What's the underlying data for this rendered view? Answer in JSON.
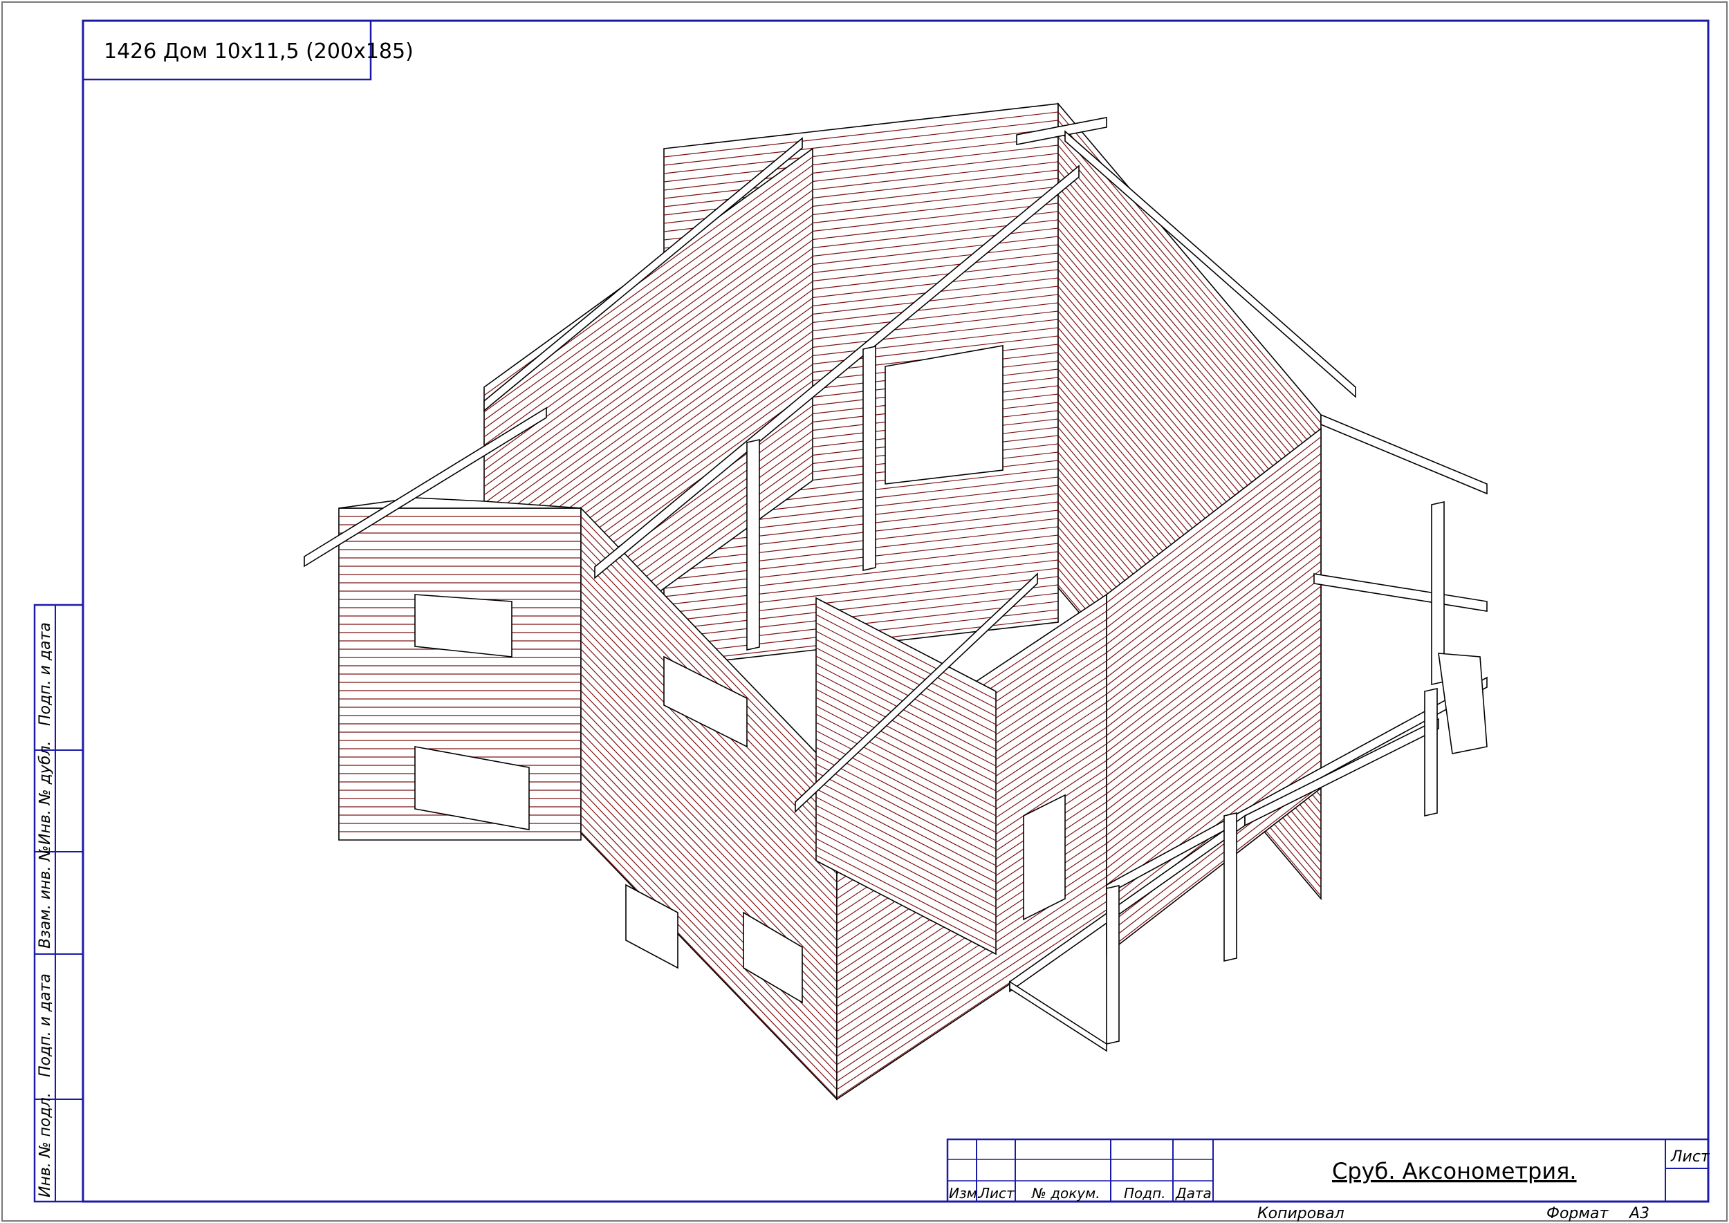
{
  "project_title": "1426 Дом 10х11,5 (200х185)",
  "drawing_title": "Сруб. Аксонометрия.",
  "title_block": {
    "col_izm": "Изм.",
    "col_list": "Лист",
    "col_doc": "№ докум.",
    "col_podp": "Подп.",
    "col_data": "Дата",
    "sheet_label": "Лист",
    "copied_by": "Копировал",
    "format_label": "Формат",
    "format_value": "А3"
  },
  "side_stamp": {
    "cells": [
      "Подп. и дата",
      "Инв. № дубл.",
      "Взам. инв. №",
      "Подп. и дата",
      "Инв. № подл."
    ]
  },
  "colors": {
    "frame": "#1a1aa8",
    "log_lines": "#7a1010",
    "edges": "#000000"
  }
}
